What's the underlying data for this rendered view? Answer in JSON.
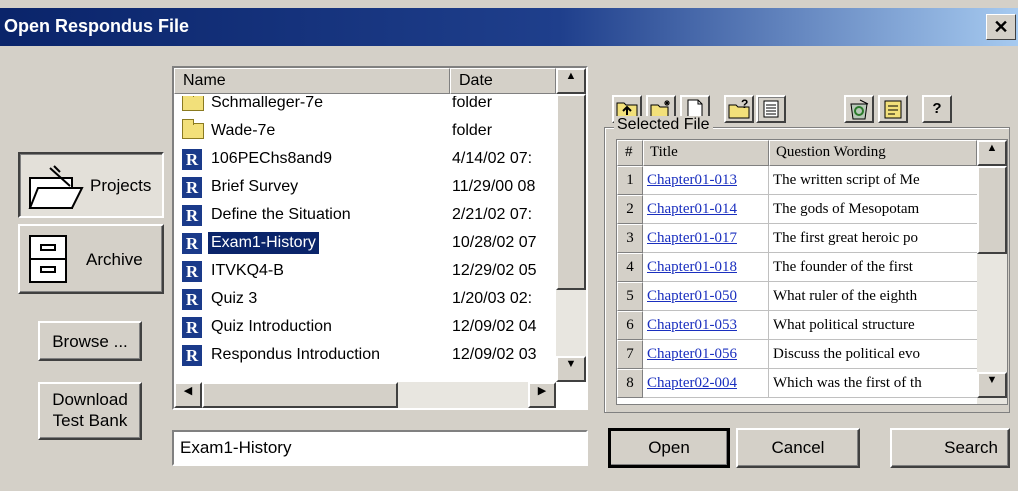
{
  "window": {
    "title": "Open Respondus File",
    "close_glyph": "✕"
  },
  "sidebar": {
    "projects_label": "Projects",
    "archive_label": "Archive",
    "browse_label": "Browse ...",
    "download_label_line1": "Download",
    "download_label_line2": "Test Bank"
  },
  "file_list": {
    "columns": {
      "name": "Name",
      "date": "Date"
    },
    "rows": [
      {
        "name": "Schmalleger-7e",
        "date": "folder",
        "icon": "folder-icon"
      },
      {
        "name": "Wade-7e",
        "date": "folder",
        "icon": "folder-icon"
      },
      {
        "name": "106PEChs8and9",
        "date": "4/14/02 07:",
        "icon": "respondus-file-icon"
      },
      {
        "name": "Brief Survey",
        "date": "11/29/00 08",
        "icon": "respondus-file-icon"
      },
      {
        "name": "Define the Situation",
        "date": "2/21/02 07:",
        "icon": "respondus-file-icon"
      },
      {
        "name": "Exam1-History",
        "date": "10/28/02 07",
        "icon": "respondus-file-icon",
        "selected": true
      },
      {
        "name": "ITVKQ4-B",
        "date": "12/29/02 05",
        "icon": "respondus-file-icon"
      },
      {
        "name": "Quiz 3",
        "date": "1/20/03 02:",
        "icon": "respondus-file-icon"
      },
      {
        "name": "Quiz Introduction",
        "date": "12/09/02 04",
        "icon": "respondus-file-icon"
      },
      {
        "name": "Respondus Introduction",
        "date": "12/09/02 03",
        "icon": "respondus-file-icon"
      }
    ],
    "r_glyph": "R"
  },
  "filename_input": {
    "value": "Exam1-History"
  },
  "toolbar": {
    "icons": [
      "up-folder-icon",
      "new-folder-icon",
      "new-file-icon",
      "help-folder-icon",
      "details-view-icon",
      "recycle-icon",
      "properties-icon",
      "help-icon"
    ],
    "help_glyph": "?"
  },
  "selected_file": {
    "group_label": "Selected File",
    "columns": {
      "num": "#",
      "title": "Title",
      "wording": "Question Wording"
    },
    "rows": [
      {
        "num": "1",
        "title": "Chapter01-013",
        "wording": "The written script of Me"
      },
      {
        "num": "2",
        "title": "Chapter01-014",
        "wording": "The gods of Mesopotam"
      },
      {
        "num": "3",
        "title": "Chapter01-017",
        "wording": "The first great heroic po"
      },
      {
        "num": "4",
        "title": "Chapter01-018",
        "wording": "The founder of the first"
      },
      {
        "num": "5",
        "title": "Chapter01-050",
        "wording": "What ruler of the eighth"
      },
      {
        "num": "6",
        "title": "Chapter01-053",
        "wording": "What political structure"
      },
      {
        "num": "7",
        "title": "Chapter01-056",
        "wording": "Discuss the political evo"
      },
      {
        "num": "8",
        "title": "Chapter02-004",
        "wording": "Which was the first of th"
      }
    ]
  },
  "footer": {
    "open_label": "Open",
    "cancel_label": "Cancel",
    "search_label": "Search"
  },
  "colors": {
    "titlebar": "#0a246a",
    "selection": "#0a246a",
    "link": "#1a2fbf",
    "face": "#d4d0c8"
  }
}
